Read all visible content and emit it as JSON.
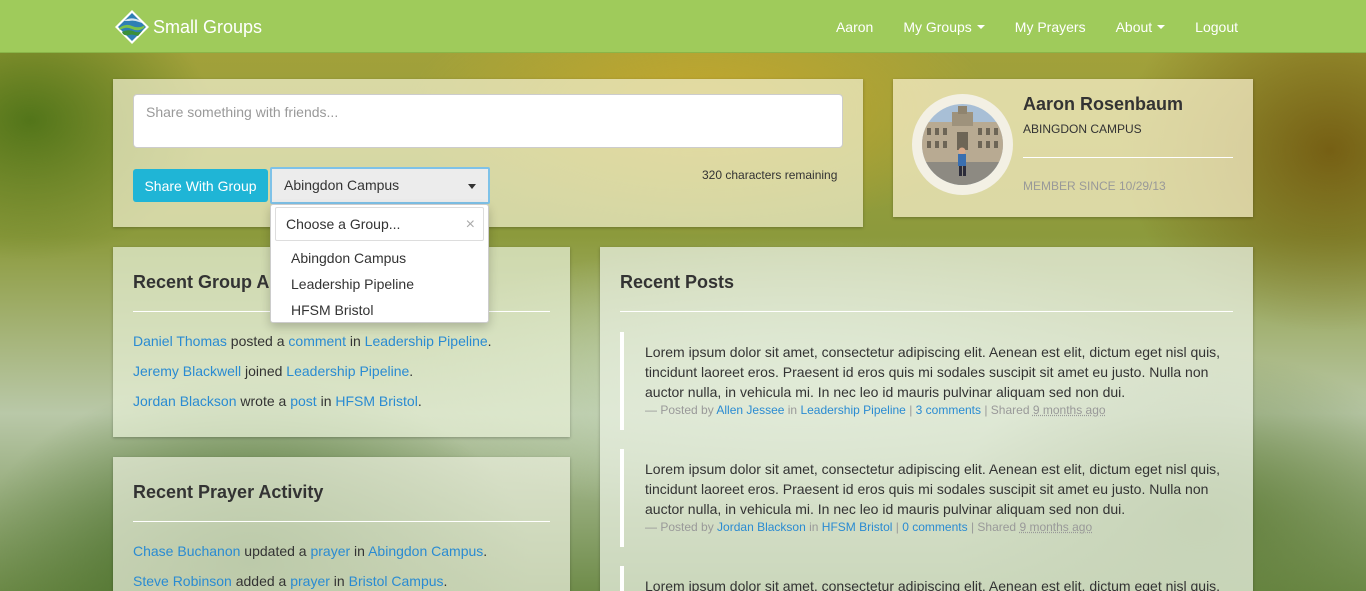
{
  "navbar": {
    "brand": "Small Groups",
    "items": [
      {
        "label": "Aaron"
      },
      {
        "label": "My Groups"
      },
      {
        "label": "My Prayers"
      },
      {
        "label": "About"
      },
      {
        "label": "Logout"
      }
    ]
  },
  "share": {
    "placeholder": "Share something with friends...",
    "button_label": "Share With Group",
    "selected_group": "Abingdon Campus",
    "chars_remaining": "320 characters remaining"
  },
  "dropdown": {
    "search_placeholder": "Choose a Group...",
    "close_glyph": "×",
    "options": [
      "Abingdon Campus",
      "Leadership Pipeline",
      "HFSM Bristol"
    ]
  },
  "profile": {
    "name": "Aaron Rosenbaum",
    "campus": "ABINGDON CAMPUS",
    "member_since": "MEMBER SINCE 10/29/13"
  },
  "group_activity": {
    "title": "Recent Group Activity",
    "items": [
      {
        "user": "Daniel Thomas",
        "verb": " posted a ",
        "object": "comment",
        "prep": " in ",
        "group": "Leadership Pipeline",
        "end": "."
      },
      {
        "user": "Jeremy Blackwell",
        "verb": " joined ",
        "group": "Leadership Pipeline",
        "end": "."
      },
      {
        "user": "Jordan Blackson",
        "verb": " wrote a ",
        "object": "post",
        "prep": " in ",
        "group": "HFSM Bristol",
        "end": "."
      }
    ]
  },
  "prayer_activity": {
    "title": "Recent Prayer Activity",
    "items": [
      {
        "user": "Chase Buchanon",
        "verb": " updated a ",
        "object": "prayer",
        "prep": " in ",
        "group": "Abingdon Campus",
        "end": "."
      },
      {
        "user": "Steve Robinson",
        "verb": " added a ",
        "object": "prayer",
        "prep": " in ",
        "group": "Bristol Campus",
        "end": "."
      }
    ]
  },
  "recent_posts": {
    "title": "Recent Posts",
    "posts": [
      {
        "body": "Lorem ipsum dolor sit amet, consectetur adipiscing elit. Aenean est elit, dictum eget nisl quis, tincidunt laoreet eros. Praesent id eros quis mi sodales suscipit sit amet eu justo. Nulla non auctor nulla, in vehicula mi. In nec leo id mauris pulvinar aliquam sed non dui.",
        "posted_by_label": "— Posted by ",
        "author": "Allen Jessee",
        "in_label": " in ",
        "group": "Leadership Pipeline",
        "sep1": " | ",
        "comments": "3 comments",
        "sep2": " | Shared ",
        "time": "9 months ago"
      },
      {
        "body": "Lorem ipsum dolor sit amet, consectetur adipiscing elit. Aenean est elit, dictum eget nisl quis, tincidunt laoreet eros. Praesent id eros quis mi sodales suscipit sit amet eu justo. Nulla non auctor nulla, in vehicula mi. In nec leo id mauris pulvinar aliquam sed non dui.",
        "posted_by_label": "— Posted by ",
        "author": "Jordan Blackson",
        "in_label": " in ",
        "group": "HFSM Bristol",
        "sep1": " | ",
        "comments": "0 comments",
        "sep2": " | Shared ",
        "time": "9 months ago"
      },
      {
        "body": "Lorem ipsum dolor sit amet, consectetur adipiscing elit. Aenean est elit, dictum eget nisl quis, tincidunt laoreet eros."
      }
    ]
  },
  "colors": {
    "navbar": "#9fcb5b",
    "link": "#2a8bd2",
    "share_button": "#1fb5d6"
  }
}
